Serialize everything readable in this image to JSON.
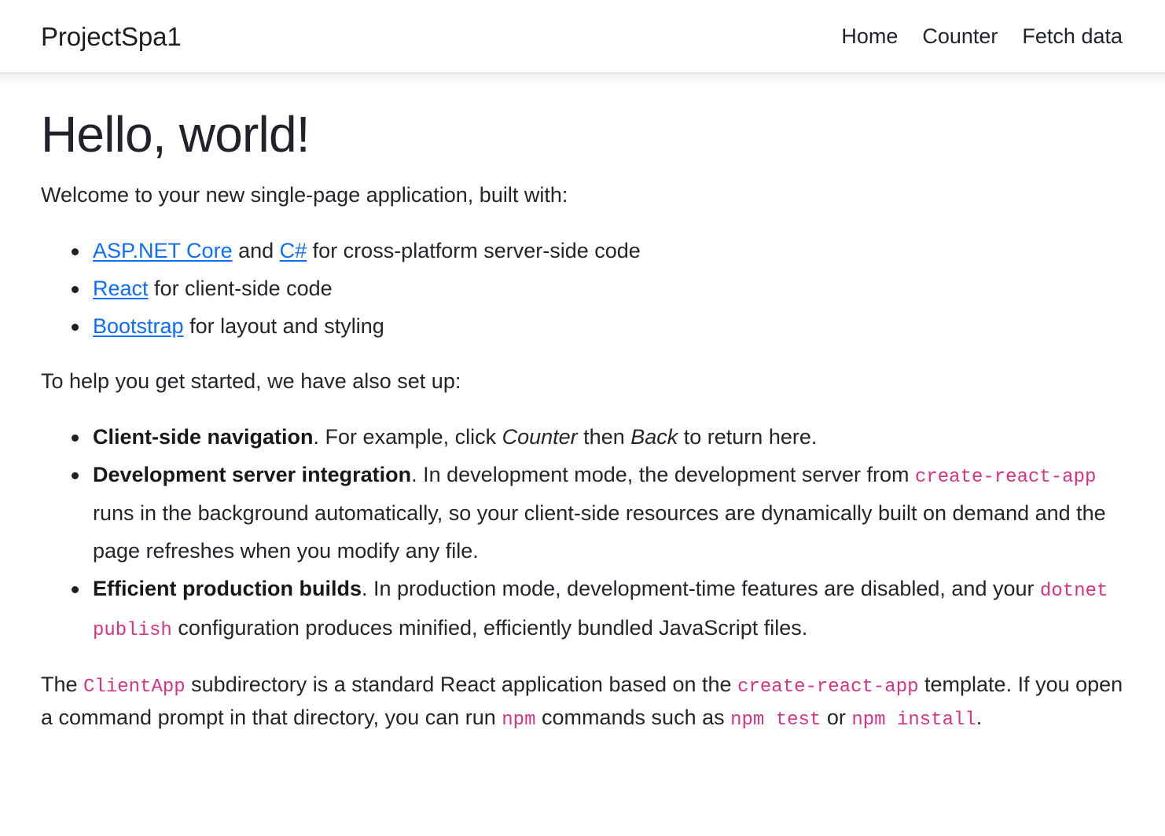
{
  "header": {
    "brand": "ProjectSpa1",
    "nav_items": [
      {
        "label": "Home"
      },
      {
        "label": "Counter"
      },
      {
        "label": "Fetch data"
      }
    ]
  },
  "main": {
    "title": "Hello, world!",
    "intro": "Welcome to your new single-page application, built with:",
    "tech_list": [
      {
        "link1": "ASP.NET Core",
        "mid": " and ",
        "link2": "C#",
        "tail": " for cross-platform server-side code"
      },
      {
        "link1": "React",
        "tail": " for client-side code"
      },
      {
        "link1": "Bootstrap",
        "tail": " for layout and styling"
      }
    ],
    "setup_intro": "To help you get started, we have also set up:",
    "features": [
      {
        "term": "Client-side navigation",
        "part1": ". For example, click ",
        "em1": "Counter",
        "part2": " then ",
        "em2": "Back",
        "part3": " to return here."
      },
      {
        "term": "Development server integration",
        "part1": ". In development mode, the development server from ",
        "code1": "create-react-app",
        "part2": " runs in the background automatically, so your client-side resources are dynamically built on demand and the page refreshes when you modify any file."
      },
      {
        "term": "Efficient production builds",
        "part1": ". In production mode, development-time features are disabled, and your ",
        "code1": "dotnet publish",
        "part2": " configuration produces minified, efficiently bundled JavaScript files."
      }
    ],
    "outro": {
      "p1": "The ",
      "code1": "ClientApp",
      "p2": " subdirectory is a standard React application based on the ",
      "code2": "create-react-app",
      "p3": " template. If you open a command prompt in that directory, you can run ",
      "code3": "npm",
      "p4": " commands such as ",
      "code4": "npm test",
      "p5": " or ",
      "code5": "npm install",
      "p6": "."
    }
  },
  "theme": {
    "link_color": "#0d6efd",
    "code_color": "#d63384",
    "text_color": "#212529",
    "border_color": "#e4e6e9",
    "background": "#ffffff"
  }
}
